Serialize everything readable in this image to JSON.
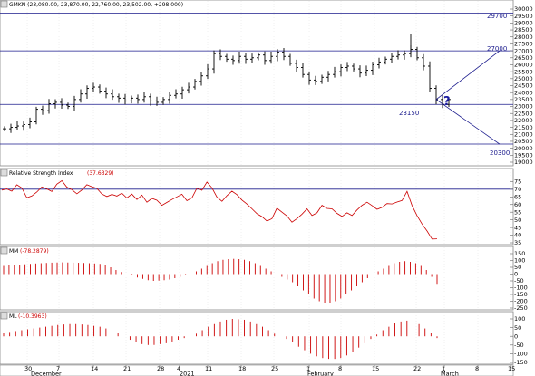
{
  "panels": {
    "price": {
      "header": "GMKN (23,080.00, 23,870.00, 22,760.00, 23,502.00, +298.000)",
      "y_ticks": [
        "30000",
        "29500",
        "29000",
        "28500",
        "28000",
        "27500",
        "27000",
        "26500",
        "26000",
        "25500",
        "25000",
        "24500",
        "24000",
        "23500",
        "23000",
        "22500",
        "22000",
        "21500",
        "21000",
        "20500",
        "20000",
        "19500",
        "19000"
      ],
      "annotations": {
        "level_29700": "29700",
        "level_27000": "27000",
        "level_23150": "23150",
        "level_20300": "20300",
        "question": "?"
      }
    },
    "rsi": {
      "header_label": "Relative Strength Index",
      "header_value": "(37.6329)",
      "y_ticks": [
        "75",
        "70",
        "65",
        "60",
        "55",
        "50",
        "45",
        "40",
        "35"
      ]
    },
    "mm": {
      "header_label": "MM",
      "header_value": "(-78.2879)",
      "y_ticks": [
        "150",
        "100",
        "50",
        "0",
        "-50",
        "-100",
        "-150",
        "-200",
        "-250"
      ]
    },
    "ml": {
      "header_label": "ML",
      "header_value": "(-10.3963)",
      "y_ticks": [
        "100",
        "50",
        "0",
        "-50",
        "-100",
        "-150"
      ]
    }
  },
  "x_axis": {
    "day_ticks": [
      "30",
      "7",
      "14",
      "21",
      "28",
      "4",
      "11",
      "18",
      "25",
      "1",
      "8",
      "15",
      "22",
      "1",
      "8",
      "15"
    ],
    "month_labels": [
      "December",
      "2021",
      "February",
      "March"
    ]
  },
  "colors": {
    "price_bars": "#000000",
    "rsi_line": "#cc0000",
    "momentum": "#cc0000",
    "level_lines": "#1a1a8c",
    "grid": "#d8d8d8"
  },
  "chart_data": {
    "type": "ohlc",
    "symbol": "GMKN",
    "x_kind": "trading-day index",
    "price": {
      "ylim": [
        19000,
        30000
      ],
      "close": [
        21400,
        21500,
        21600,
        21700,
        21900,
        22800,
        22700,
        23200,
        23300,
        23100,
        23000,
        23500,
        23900,
        24300,
        24400,
        24100,
        23900,
        23700,
        23600,
        23400,
        23600,
        23500,
        23700,
        23400,
        23300,
        23500,
        23800,
        23900,
        24200,
        24400,
        24800,
        25200,
        25700,
        26800,
        26600,
        26400,
        26300,
        26600,
        26400,
        26500,
        26700,
        26300,
        26600,
        26900,
        26600,
        26100,
        25800,
        25300,
        24900,
        24800,
        25100,
        25300,
        25500,
        25800,
        25900,
        25700,
        25400,
        25600,
        26000,
        26200,
        26400,
        26600,
        26700,
        26800,
        27100,
        26500,
        25900,
        24300,
        23500,
        23150,
        23502
      ],
      "levels": [
        29700,
        27000,
        23150,
        20300
      ],
      "forecast_lines": [
        {
          "from": [
            68,
            23502
          ],
          "to": [
            82,
            27000
          ]
        },
        {
          "from": [
            68,
            23502
          ],
          "to": [
            82,
            20300
          ]
        }
      ]
    },
    "rsi": {
      "ylim": [
        35,
        77
      ],
      "level": 70,
      "values": [
        69.4,
        70.2,
        68.7,
        72.9,
        70.8,
        64.4,
        65.6,
        68.1,
        71.5,
        70.2,
        68.5,
        73.3,
        75.6,
        71.4,
        69.7,
        67.0,
        69.5,
        72.9,
        71.6,
        70.6,
        66.9,
        65.2,
        66.6,
        65.5,
        67.4,
        64.3,
        66.8,
        63.3,
        66.2,
        61.5,
        64.0,
        62.8,
        59.5,
        61.4,
        63.3,
        65.0,
        66.7,
        62.5,
        64.4,
        70.7,
        69.3,
        74.7,
        70.9,
        64.9,
        62.1,
        65.8,
        68.7,
        66.5,
        62.9,
        60.3,
        57.2,
        54.0,
        52.1,
        49.2,
        50.8,
        57.6,
        55.0,
        52.5,
        48.5,
        50.8,
        53.7,
        57.2,
        52.8,
        54.6,
        59.5,
        57.5,
        57.2,
        54.2,
        52.2,
        54.6,
        52.8,
        56.4,
        59.5,
        61.5,
        59.3,
        56.9,
        58.1,
        60.6,
        60.4,
        61.6,
        62.6,
        68.6,
        59.4,
        52.8,
        47.3,
        42.7,
        37.4,
        37.6
      ],
      "last": 37.6329
    },
    "momentum_mm": {
      "ylim": [
        -250,
        150
      ],
      "values": [
        60,
        65,
        68,
        70,
        72,
        75,
        78,
        80,
        82,
        84,
        85,
        86,
        85,
        84,
        83,
        82,
        80,
        78,
        75,
        70,
        50,
        30,
        15,
        0,
        -10,
        -25,
        -35,
        -45,
        -50,
        -48,
        -45,
        -40,
        -30,
        -20,
        -10,
        0,
        20,
        40,
        60,
        80,
        95,
        105,
        110,
        112,
        110,
        105,
        95,
        80,
        60,
        40,
        20,
        0,
        -20,
        -40,
        -60,
        -90,
        -120,
        -150,
        -180,
        -200,
        -210,
        -210,
        -200,
        -180,
        -150,
        -120,
        -90,
        -60,
        -30,
        0,
        20,
        40,
        60,
        80,
        90,
        95,
        90,
        80,
        60,
        30,
        -20,
        -78
      ]
    },
    "momentum_ml": {
      "ylim": [
        -150,
        100
      ],
      "values": [
        20,
        25,
        30,
        35,
        40,
        45,
        50,
        55,
        60,
        65,
        68,
        70,
        70,
        68,
        65,
        60,
        55,
        45,
        35,
        20,
        0,
        -20,
        -35,
        -45,
        -50,
        -50,
        -45,
        -40,
        -30,
        -20,
        -10,
        0,
        15,
        35,
        55,
        70,
        85,
        95,
        100,
        98,
        95,
        85,
        70,
        55,
        35,
        15,
        0,
        -15,
        -35,
        -60,
        -80,
        -100,
        -115,
        -125,
        -130,
        -130,
        -125,
        -110,
        -90,
        -65,
        -40,
        -15,
        10,
        35,
        55,
        75,
        85,
        90,
        85,
        70,
        45,
        20,
        -10
      ]
    }
  }
}
